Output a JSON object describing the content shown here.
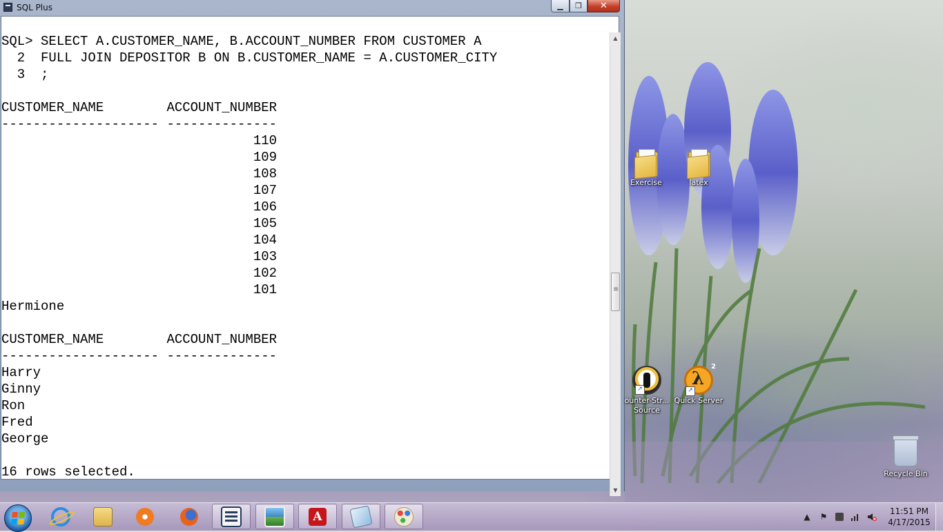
{
  "window": {
    "title": "SQL Plus",
    "close_glyph": "✕",
    "maximize_glyph": "❐",
    "minimize_glyph": "▁"
  },
  "console": {
    "lines": [
      "SQL> SELECT A.CUSTOMER_NAME, B.ACCOUNT_NUMBER FROM CUSTOMER A",
      "  2  FULL JOIN DEPOSITOR B ON B.CUSTOMER_NAME = A.CUSTOMER_CITY",
      "  3  ;",
      "",
      "CUSTOMER_NAME        ACCOUNT_NUMBER",
      "-------------------- --------------",
      "                                110",
      "                                109",
      "                                108",
      "                                107",
      "                                106",
      "                                105",
      "                                104",
      "                                103",
      "                                102",
      "                                101",
      "Hermione",
      "",
      "CUSTOMER_NAME        ACCOUNT_NUMBER",
      "-------------------- --------------",
      "Harry",
      "Ginny",
      "Ron",
      "Fred",
      "George",
      "",
      "16 rows selected."
    ]
  },
  "desktop": {
    "icons": [
      {
        "label": "Exercise",
        "icon": "folder-icon"
      },
      {
        "label": "latex",
        "icon": "folder-icon"
      },
      {
        "label": "ounter-Str...",
        "label2": "Source",
        "icon": "counter-strike-icon"
      },
      {
        "label": "Quick Server",
        "icon": "half-life-2-icon",
        "badge": "2"
      },
      {
        "label": "Recycle Bin",
        "icon": "recycle-bin-icon"
      }
    ]
  },
  "taskbar": {
    "apps": [
      {
        "name": "internet-explorer-icon"
      },
      {
        "name": "windows-explorer-icon"
      },
      {
        "name": "media-player-icon"
      },
      {
        "name": "firefox-icon"
      },
      {
        "name": "sql-plus-icon",
        "active": true
      },
      {
        "name": "photo-viewer-icon"
      },
      {
        "name": "adobe-reader-icon",
        "glyph": "A"
      },
      {
        "name": "snipping-tool-icon"
      },
      {
        "name": "paint-icon"
      }
    ],
    "tray": {
      "arrow": "▲",
      "flag": "⚑",
      "clock_time": "11:51 PM",
      "clock_date": "4/17/2015"
    }
  }
}
